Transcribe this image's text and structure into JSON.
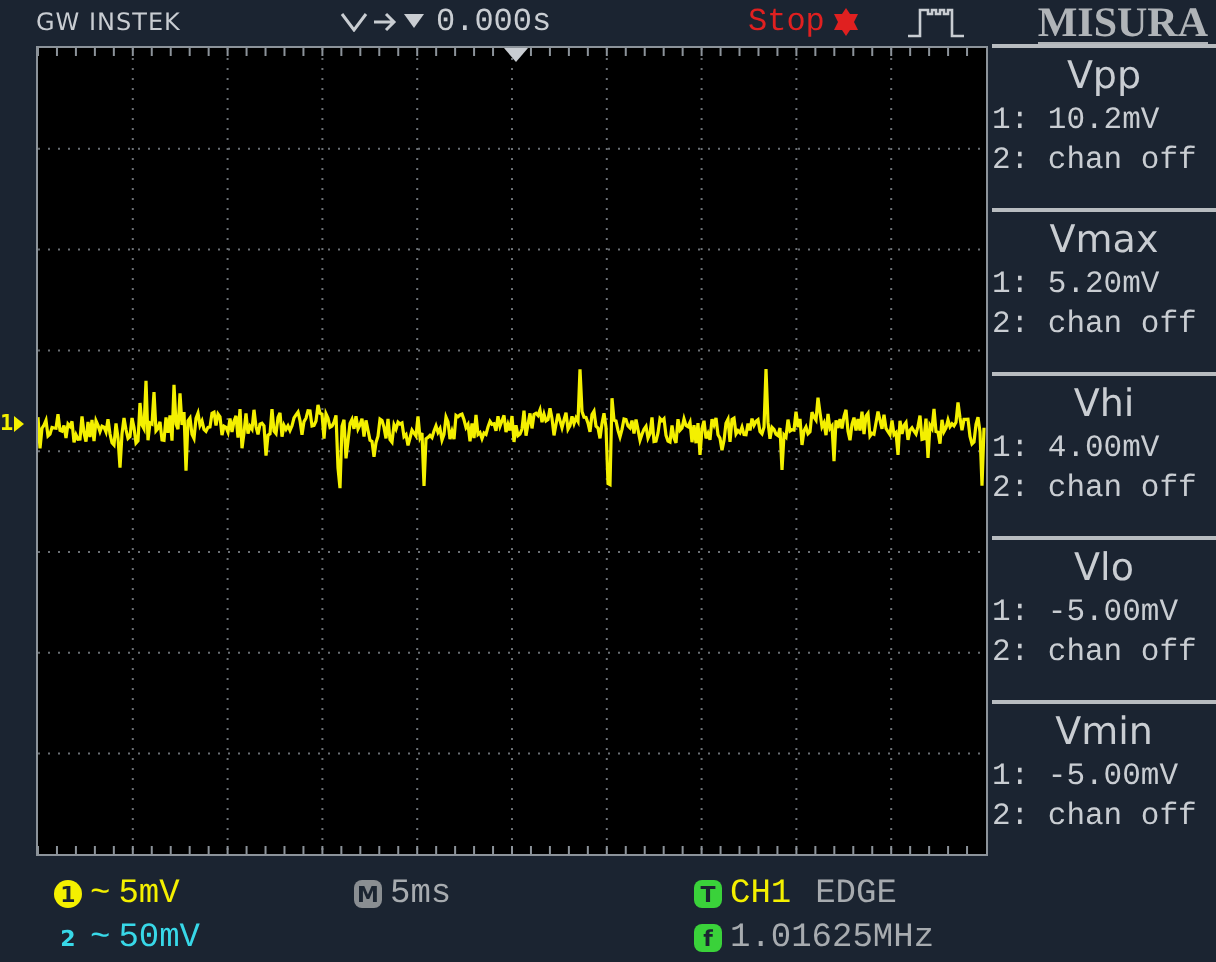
{
  "header": {
    "brand": "GW INSTEK",
    "position": "0.000s",
    "run_state": "Stop",
    "menu_title": "MISURA"
  },
  "screen": {
    "channel_marker": "1"
  },
  "measurements": [
    {
      "name": "Vpp",
      "ch1": "1: 10.2mV",
      "ch2": "2: chan off"
    },
    {
      "name": "Vmax",
      "ch1": "1: 5.20mV",
      "ch2": "2: chan off"
    },
    {
      "name": "Vhi",
      "ch1": "1: 4.00mV",
      "ch2": "2: chan off"
    },
    {
      "name": "Vlo",
      "ch1": "1: -5.00mV",
      "ch2": "2: chan off"
    },
    {
      "name": "Vmin",
      "ch1": "1: -5.00mV",
      "ch2": "2: chan off"
    }
  ],
  "footer": {
    "channels": [
      {
        "label": "1",
        "coupling": "~",
        "scale": "5mV",
        "color": "#f4f000"
      },
      {
        "label": "2",
        "coupling": "~",
        "scale": "50mV",
        "color": "#38d8e8"
      }
    ],
    "timebase": {
      "badge": "M",
      "value": "5ms"
    },
    "trigger": {
      "badge": "T",
      "source": "CH1",
      "type": "EDGE"
    },
    "frequency": {
      "badge": "f",
      "value": "1.01625MHz"
    }
  }
}
